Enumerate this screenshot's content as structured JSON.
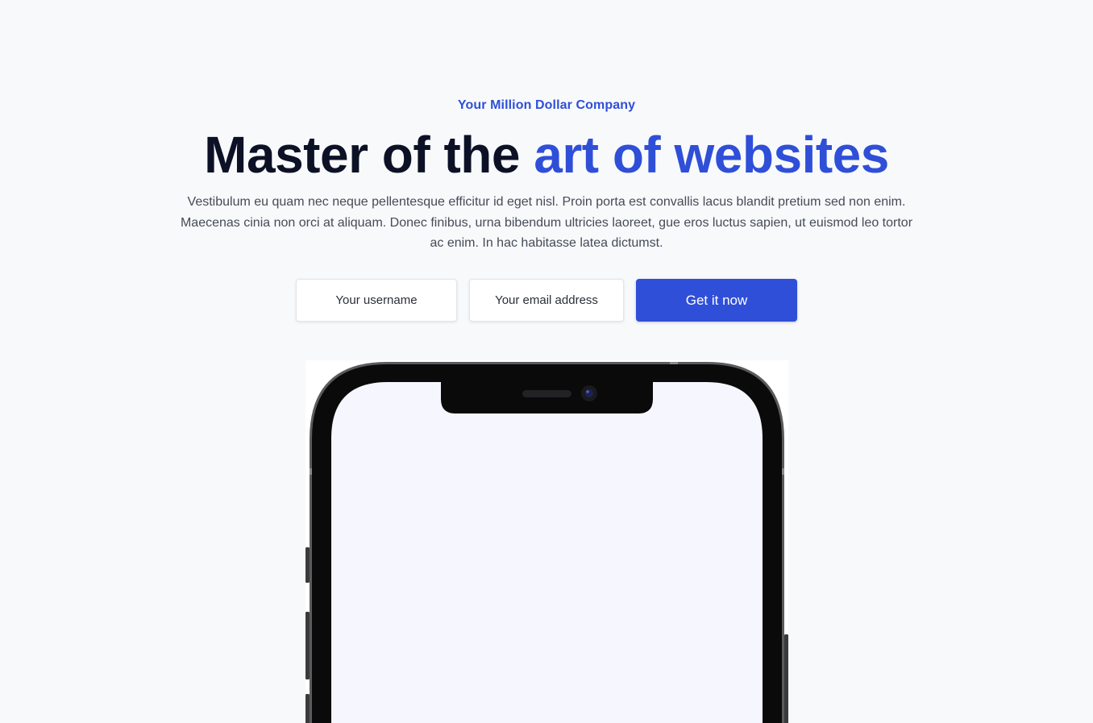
{
  "hero": {
    "eyebrow": "Your Million Dollar Company",
    "headline_main": "Master of the ",
    "headline_accent": "art of websites",
    "lead": "Vestibulum eu quam nec neque pellentesque efficitur id eget nisl. Proin porta est convallis lacus blandit pretium sed non enim. Maecenas cinia non orci at aliquam. Donec finibus, urna bibendum ultricies laoreet, gue eros luctus sapien, ut euismod leo tortor ac enim. In hac habitasse latea dictumst."
  },
  "form": {
    "username_placeholder": "Your username",
    "email_placeholder": "Your email address",
    "submit_label": "Get it now"
  },
  "colors": {
    "accent": "#2f4fd8",
    "headline": "#0c1126",
    "background": "#f8f9fb",
    "phone_screen": "#f6f7fe"
  },
  "icons": {
    "device": "smartphone-mockup-icon"
  }
}
